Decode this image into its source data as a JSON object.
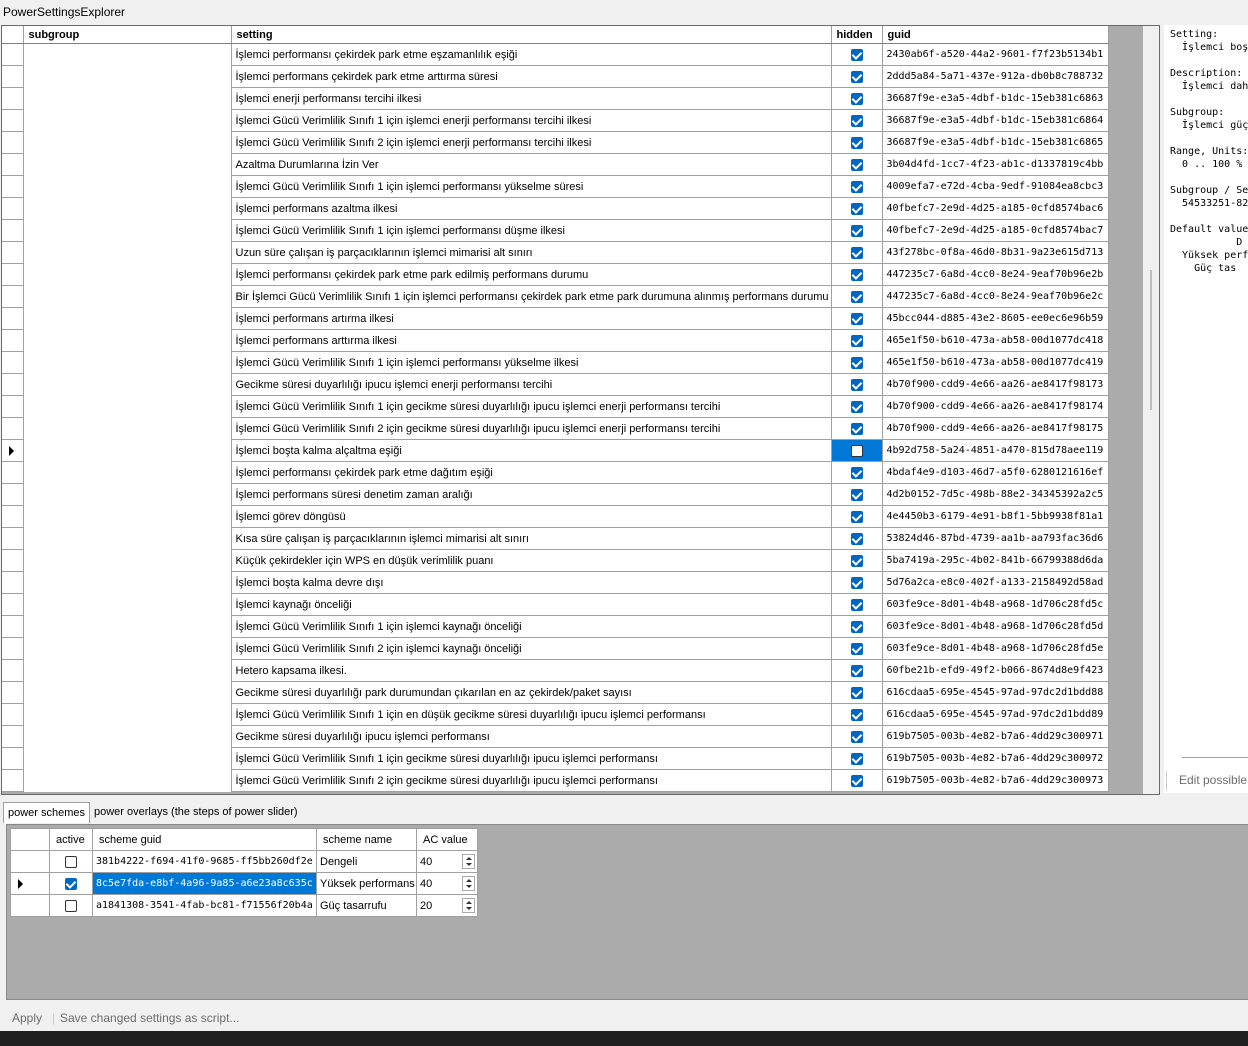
{
  "window": {
    "title": "PowerSettingsExplorer"
  },
  "grid": {
    "headers": {
      "subgroup": "subgroup",
      "setting": "setting",
      "hidden": "hidden",
      "guid": "guid"
    },
    "rows": [
      {
        "setting": "İşlemci performansı çekirdek park etme eşzamanlılık eşiği",
        "hidden": true,
        "guid": "2430ab6f-a520-44a2-9601-f7f23b5134b1"
      },
      {
        "setting": "İşlemci performans çekirdek park etme arttırma süresi",
        "hidden": true,
        "guid": "2ddd5a84-5a71-437e-912a-db0b8c788732"
      },
      {
        "setting": "İşlemci enerji performansı tercihi ilkesi",
        "hidden": true,
        "guid": "36687f9e-e3a5-4dbf-b1dc-15eb381c6863"
      },
      {
        "setting": "İşlemci Gücü Verimlilik Sınıfı 1 için işlemci enerji performansı tercihi ilkesi",
        "hidden": true,
        "guid": "36687f9e-e3a5-4dbf-b1dc-15eb381c6864"
      },
      {
        "setting": "İşlemci Gücü Verimlilik Sınıfı 2 için işlemci enerji performansı tercihi ilkesi",
        "hidden": true,
        "guid": "36687f9e-e3a5-4dbf-b1dc-15eb381c6865"
      },
      {
        "setting": "Azaltma Durumlarına İzin Ver",
        "hidden": true,
        "guid": "3b04d4fd-1cc7-4f23-ab1c-d1337819c4bb"
      },
      {
        "setting": "İşlemci Gücü Verimlilik Sınıfı 1 için işlemci performansı yükselme süresi",
        "hidden": true,
        "guid": "4009efa7-e72d-4cba-9edf-91084ea8cbc3"
      },
      {
        "setting": "İşlemci performans azaltma ilkesi",
        "hidden": true,
        "guid": "40fbefc7-2e9d-4d25-a185-0cfd8574bac6"
      },
      {
        "setting": "İşlemci Gücü Verimlilik Sınıfı 1 için işlemci performansı düşme ilkesi",
        "hidden": true,
        "guid": "40fbefc7-2e9d-4d25-a185-0cfd8574bac7"
      },
      {
        "setting": "Uzun süre çalışan iş parçacıklarının işlemci mimarisi alt sınırı",
        "hidden": true,
        "guid": "43f278bc-0f8a-46d0-8b31-9a23e615d713"
      },
      {
        "setting": "İşlemci performansı çekirdek park etme park edilmiş performans durumu",
        "hidden": true,
        "guid": "447235c7-6a8d-4cc0-8e24-9eaf70b96e2b"
      },
      {
        "setting": "Bir İşlemci Gücü Verimlilik Sınıfı 1 için işlemci performansı çekirdek park etme park durumuna alınmış performans durumu",
        "hidden": true,
        "guid": "447235c7-6a8d-4cc0-8e24-9eaf70b96e2c"
      },
      {
        "setting": "İşlemci performans artırma ilkesi",
        "hidden": true,
        "guid": "45bcc044-d885-43e2-8605-ee0ec6e96b59"
      },
      {
        "setting": "İşlemci performans arttırma ilkesi",
        "hidden": true,
        "guid": "465e1f50-b610-473a-ab58-00d1077dc418"
      },
      {
        "setting": "İşlemci Gücü Verimlilik Sınıfı 1 için işlemci performansı yükselme ilkesi",
        "hidden": true,
        "guid": "465e1f50-b610-473a-ab58-00d1077dc419"
      },
      {
        "setting": "Gecikme süresi duyarlılığı ipucu işlemci enerji performansı tercihi",
        "hidden": true,
        "guid": "4b70f900-cdd9-4e66-aa26-ae8417f98173"
      },
      {
        "setting": "İşlemci Gücü Verimlilik Sınıfı 1 için gecikme süresi duyarlılığı ipucu işlemci enerji performansı tercihi",
        "hidden": true,
        "guid": "4b70f900-cdd9-4e66-aa26-ae8417f98174"
      },
      {
        "setting": "İşlemci Gücü Verimlilik Sınıfı 2 için gecikme süresi duyarlılığı ipucu işlemci enerji performansı tercihi",
        "hidden": true,
        "guid": "4b70f900-cdd9-4e66-aa26-ae8417f98175"
      },
      {
        "setting": "İşlemci boşta kalma alçaltma eşiği",
        "hidden": false,
        "guid": "4b92d758-5a24-4851-a470-815d78aee119",
        "current": true
      },
      {
        "setting": "İşlemci performansı çekirdek park etme dağıtım eşiği",
        "hidden": true,
        "guid": "4bdaf4e9-d103-46d7-a5f0-6280121616ef"
      },
      {
        "setting": "İşlemci performans süresi denetim zaman aralığı",
        "hidden": true,
        "guid": "4d2b0152-7d5c-498b-88e2-34345392a2c5"
      },
      {
        "setting": "İşlemci görev döngüsü",
        "hidden": true,
        "guid": "4e4450b3-6179-4e91-b8f1-5bb9938f81a1"
      },
      {
        "setting": "Kısa süre çalışan iş parçacıklarının işlemci mimarisi alt sınırı",
        "hidden": true,
        "guid": "53824d46-87bd-4739-aa1b-aa793fac36d6"
      },
      {
        "setting": "Küçük çekirdekler için WPS en düşük verimlilik puanı",
        "hidden": true,
        "guid": "5ba7419a-295c-4b02-841b-66799388d6da"
      },
      {
        "setting": "İşlemci boşta kalma devre dışı",
        "hidden": true,
        "guid": "5d76a2ca-e8c0-402f-a133-2158492d58ad"
      },
      {
        "setting": "İşlemci kaynağı önceliği",
        "hidden": true,
        "guid": "603fe9ce-8d01-4b48-a968-1d706c28fd5c"
      },
      {
        "setting": "İşlemci Gücü Verimlilik Sınıfı 1 için işlemci kaynağı önceliği",
        "hidden": true,
        "guid": "603fe9ce-8d01-4b48-a968-1d706c28fd5d"
      },
      {
        "setting": "İşlemci Gücü Verimlilik Sınıfı 2 için işlemci kaynağı önceliği",
        "hidden": true,
        "guid": "603fe9ce-8d01-4b48-a968-1d706c28fd5e"
      },
      {
        "setting": "Hetero kapsama ilkesi.",
        "hidden": true,
        "guid": "60fbe21b-efd9-49f2-b066-8674d8e9f423"
      },
      {
        "setting": "Gecikme süresi duyarlılığı park durumundan çıkarılan en az çekirdek/paket sayısı",
        "hidden": true,
        "guid": "616cdaa5-695e-4545-97ad-97dc2d1bdd88"
      },
      {
        "setting": "İşlemci Gücü Verimlilik Sınıfı 1 için en düşük gecikme süresi duyarlılığı ipucu işlemci performansı",
        "hidden": true,
        "guid": "616cdaa5-695e-4545-97ad-97dc2d1bdd89"
      },
      {
        "setting": "Gecikme süresi duyarlılığı ipucu işlemci performansı",
        "hidden": true,
        "guid": "619b7505-003b-4e82-b7a6-4dd29c300971"
      },
      {
        "setting": "İşlemci Gücü Verimlilik Sınıfı 1 için gecikme süresi duyarlılığı ipucu işlemci performansı",
        "hidden": true,
        "guid": "619b7505-003b-4e82-b7a6-4dd29c300972"
      },
      {
        "setting": "İşlemci Gücü Verimlilik Sınıfı 2 için gecikme süresi duyarlılığı ipucu işlemci performansı",
        "hidden": true,
        "guid": "619b7505-003b-4e82-b7a6-4dd29c300973"
      }
    ]
  },
  "details": {
    "text": "Setting:\n  İşlemci boş\n\nDescription:\n  İşlemci dah\n\nSubgroup:\n  İşlemci güç\n\nRange, Units:\n  0 .. 100 %\n\nSubgroup / Se\n  54533251-82\n\nDefault value\n           D\n  Yüksek perf\n    Güç tas",
    "edit_label": "Edit possible v"
  },
  "tabs": {
    "power_schemes": "power schemes",
    "power_overlays": "power overlays (the steps of power slider)"
  },
  "schemes": {
    "headers": {
      "active": "active",
      "scheme_guid": "scheme guid",
      "scheme_name": "scheme name",
      "ac_value": "AC value"
    },
    "rows": [
      {
        "active": false,
        "guid": "381b4222-f694-41f0-9685-ff5bb260df2e",
        "name": "Dengeli",
        "ac": "40"
      },
      {
        "active": true,
        "guid": "8c5e7fda-e8bf-4a96-9a85-a6e23a8c635c",
        "name": "Yüksek performans",
        "ac": "40",
        "current": true
      },
      {
        "active": false,
        "guid": "a1841308-3541-4fab-bc81-f71556f20b4a",
        "name": "Güç tasarrufu",
        "ac": "20"
      }
    ]
  },
  "footer": {
    "apply": "Apply",
    "save_script": "Save changed settings as script..."
  }
}
